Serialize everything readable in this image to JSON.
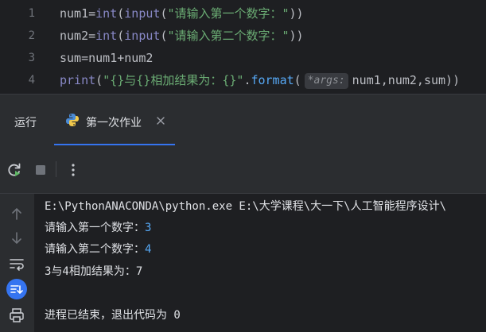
{
  "editor": {
    "lines": [
      {
        "num": "1",
        "p1": "num1=",
        "builtin1": "int",
        "p2": "(",
        "builtin2": "input",
        "p3": "(",
        "str": "\"请输入第一个数字：\"",
        "p4": "))"
      },
      {
        "num": "2",
        "p1": "num2=",
        "builtin1": "int",
        "p2": "(",
        "builtin2": "input",
        "p3": "(",
        "str": "\"请输入第二个数字：\"",
        "p4": "))"
      },
      {
        "num": "3",
        "text": "sum=num1+num2"
      },
      {
        "num": "4",
        "builtin": "print",
        "p1": "(",
        "str": "\"{}与{}相加结果为：{}\"",
        "p2": ".",
        "fn": "format",
        "p3": "(",
        "hint": "*args:",
        "args": "num1,num2,sum))"
      }
    ]
  },
  "run_panel": {
    "title": "运行",
    "tab_label": "第一次作业"
  },
  "console": {
    "command": "E:\\PythonANACONDA\\python.exe E:\\大学课程\\大一下\\人工智能程序设计\\",
    "prompt1": "请输入第一个数字：",
    "input1": "3",
    "prompt2": "请输入第二个数字：",
    "input2": "4",
    "result": "3与4相加结果为：7",
    "exit_msg": "进程已结束，退出代码为 0"
  },
  "colors": {
    "accent": "#3574f0",
    "string": "#6aab73",
    "builtin": "#8888c6",
    "function": "#56a8f5"
  }
}
